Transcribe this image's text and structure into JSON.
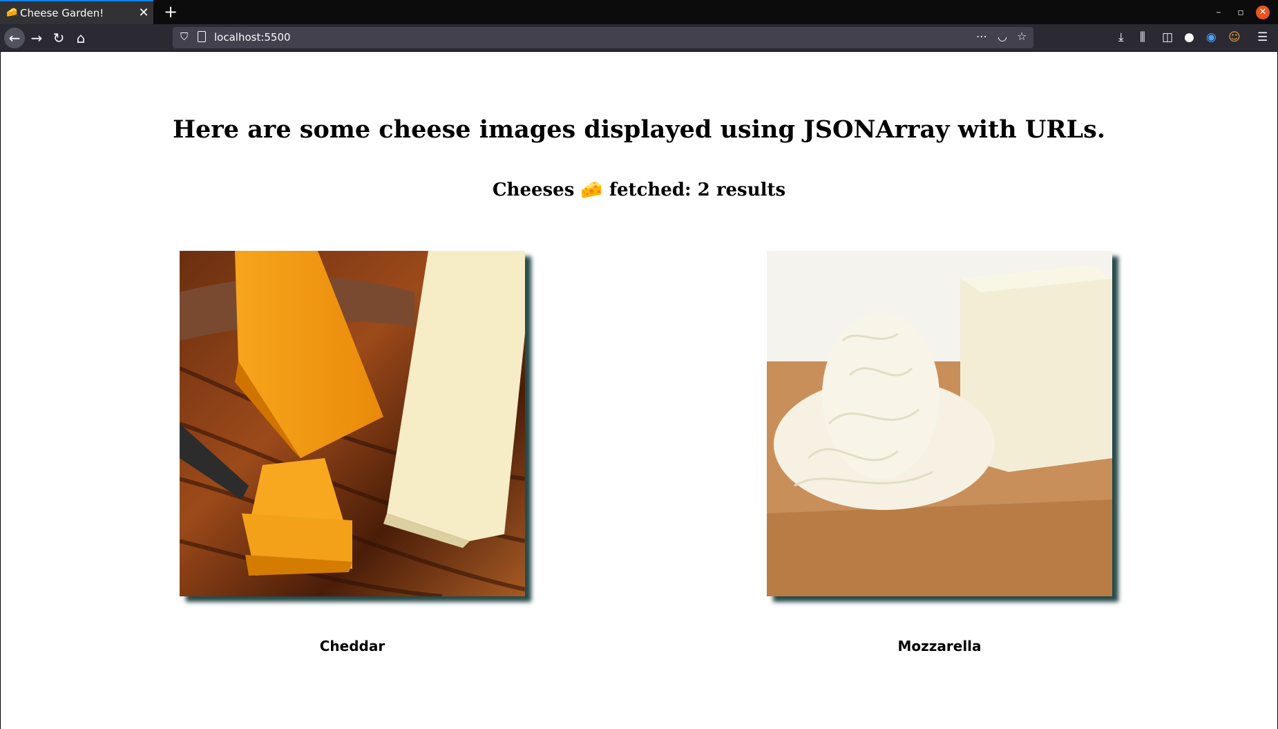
{
  "browser": {
    "tab_title": "Cheese Garden!",
    "tab_icon": "cheese-icon",
    "url": "localhost:5500",
    "accent": "#0a84ff"
  },
  "page": {
    "heading": "Here are some cheese images displayed using JSONArray with URLs.",
    "subheading": "Cheeses 🧀 fetched: 2 results",
    "cheeses": [
      {
        "name": "Cheddar",
        "image": "cheddar-photo"
      },
      {
        "name": "Mozzarella",
        "image": "mozzarella-photo"
      }
    ]
  }
}
